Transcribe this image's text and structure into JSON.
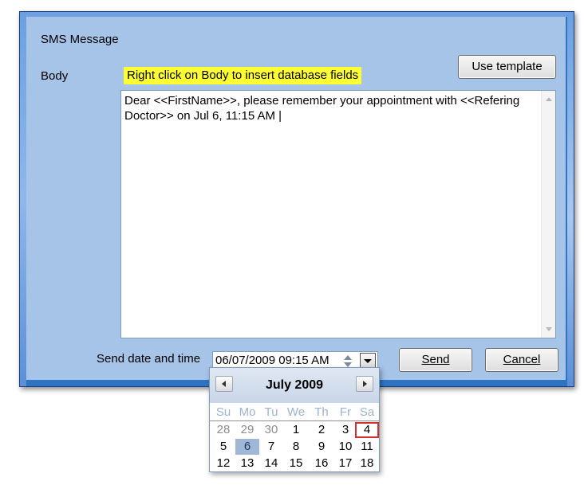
{
  "dialog": {
    "title": "SMS Message",
    "body_label": "Body",
    "hint": "Right click on Body to insert database fields",
    "use_template_label": "Use template",
    "body_text": "Dear <<FirstName>>, please remember your appointment with <<Refering Doctor>> on Jul 6, 11:15 AM |",
    "send_date_label": "Send date and time",
    "send_date_value": "06/07/2009 09:15 AM",
    "send_label": "Send",
    "cancel_label": "Cancel"
  },
  "calendar": {
    "month_title": "July 2009",
    "weekdays": [
      "Su",
      "Mo",
      "Tu",
      "We",
      "Th",
      "Fr",
      "Sa"
    ],
    "rows": [
      [
        "28",
        "29",
        "30",
        "1",
        "2",
        "3",
        "4"
      ],
      [
        "5",
        "6",
        "7",
        "8",
        "9",
        "10",
        "11"
      ],
      [
        "12",
        "13",
        "14",
        "15",
        "16",
        "17",
        "18"
      ]
    ],
    "selected_day": "6",
    "today_day": "4"
  },
  "colors": {
    "dialog_background": "#a6c3e8",
    "hint_highlight": "#ffff33",
    "frame": "#2f73c4",
    "today_outline": "#d43030",
    "selected_day_fill": "#a0b8d6"
  },
  "icons": {
    "scroll_up": "triangle-up-icon",
    "scroll_down": "triangle-down-icon",
    "spin_up": "spin-up-icon",
    "spin_down": "spin-down-icon",
    "dropdown": "chevron-down-icon",
    "prev_month": "chevron-left-icon",
    "next_month": "chevron-right-icon"
  }
}
